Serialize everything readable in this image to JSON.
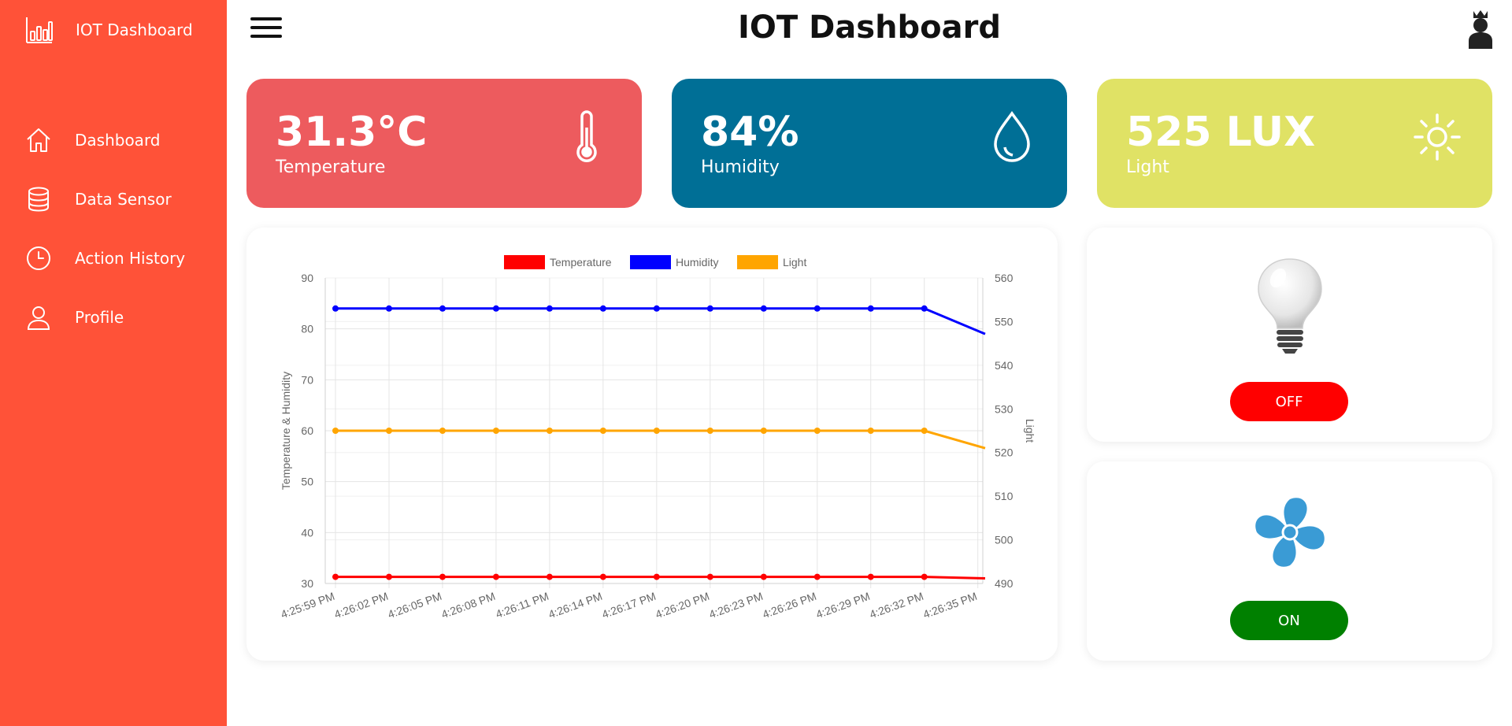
{
  "sidebar": {
    "brand": {
      "label": "IOT Dashboard",
      "icon": "bar-chart-icon"
    },
    "items": [
      {
        "label": "Dashboard",
        "icon": "home-icon"
      },
      {
        "label": "Data Sensor",
        "icon": "database-icon"
      },
      {
        "label": "Action History",
        "icon": "clock-icon"
      },
      {
        "label": "Profile",
        "icon": "user-icon"
      }
    ]
  },
  "header": {
    "title": "IOT Dashboard",
    "menu_icon": "hamburger-menu-icon",
    "avatar_icon": "king-avatar-icon"
  },
  "stats": {
    "temperature": {
      "value": "31.3°C",
      "label": "Temperature",
      "icon": "thermometer-icon",
      "color": "#ed5b5e"
    },
    "humidity": {
      "value": "84%",
      "label": "Humidity",
      "icon": "water-drop-icon",
      "color": "#006f96"
    },
    "light": {
      "value": "525 LUX",
      "label": "Light",
      "icon": "sun-icon",
      "color": "#e0e265"
    }
  },
  "devices": {
    "bulb": {
      "icon": "light-bulb-icon",
      "button_label": "OFF",
      "state": "off",
      "color": "#ff0000"
    },
    "fan": {
      "icon": "fan-icon",
      "button_label": "ON",
      "state": "on",
      "color": "#008000"
    }
  },
  "chart_data": {
    "type": "line",
    "legend_position": "top",
    "grid": true,
    "xlabel": "",
    "ylabel": "Temperature & Humidity",
    "y2label": "Light",
    "ylim": [
      30,
      90
    ],
    "y2lim": [
      490,
      560
    ],
    "x": [
      "4:25:59 PM",
      "4:26:02 PM",
      "4:26:05 PM",
      "4:26:08 PM",
      "4:26:11 PM",
      "4:26:14 PM",
      "4:26:17 PM",
      "4:26:20 PM",
      "4:26:23 PM",
      "4:26:26 PM",
      "4:26:29 PM",
      "4:26:32 PM",
      "4:26:35 PM"
    ],
    "series": [
      {
        "name": "Temperature",
        "axis": "left",
        "color": "#ff0000",
        "values": [
          31.3,
          31.3,
          31.3,
          31.3,
          31.3,
          31.3,
          31.3,
          31.3,
          31.3,
          31.3,
          31.3,
          31.3,
          31
        ]
      },
      {
        "name": "Humidity",
        "axis": "left",
        "color": "#0000ff",
        "values": [
          84,
          84,
          84,
          84,
          84,
          84,
          84,
          84,
          84,
          84,
          84,
          84,
          79
        ]
      },
      {
        "name": "Light",
        "axis": "right",
        "color": "#ffa500",
        "values": [
          525,
          525,
          525,
          525,
          525,
          525,
          525,
          525,
          525,
          525,
          525,
          525,
          521
        ]
      }
    ],
    "y_ticks": [
      30,
      40,
      50,
      60,
      70,
      80,
      90
    ],
    "y2_ticks": [
      490,
      500,
      510,
      520,
      530,
      540,
      550,
      560
    ]
  }
}
